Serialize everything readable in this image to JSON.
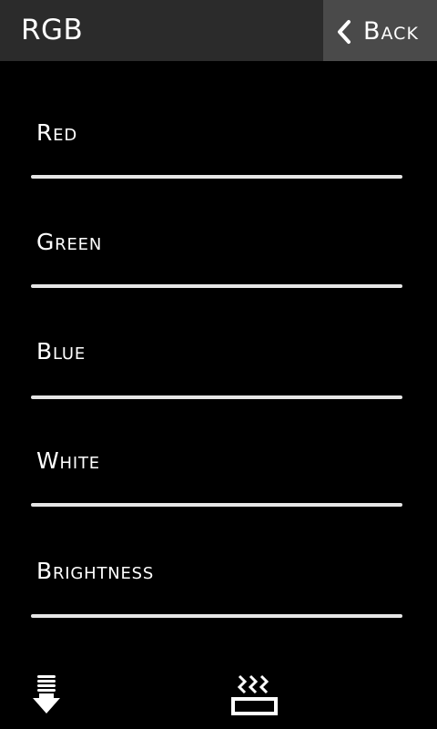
{
  "header": {
    "title": "RGB",
    "back_label": "Back"
  },
  "sliders": [
    {
      "label": "Red"
    },
    {
      "label": "Green"
    },
    {
      "label": "Blue"
    },
    {
      "label": "White"
    },
    {
      "label": "Brightness"
    }
  ],
  "bottom_bar": {
    "left_icon": "bulb-down-icon",
    "right_icon": "heat-waves-icon"
  },
  "colors": {
    "header_bg": "#2b2b2b",
    "back_button_bg": "#4a4a4a",
    "background": "#000000",
    "track": "#e6e6e6"
  }
}
